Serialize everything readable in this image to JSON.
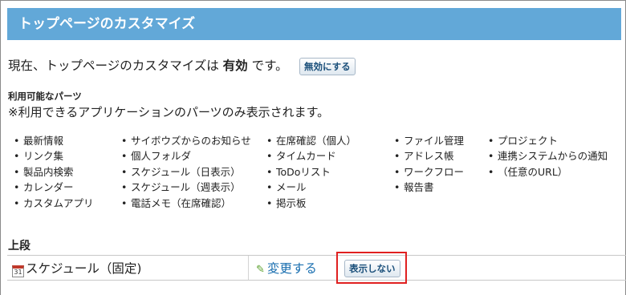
{
  "header": {
    "title": "トップページのカスタマイズ"
  },
  "status": {
    "prefix": "現在、トップページのカスタマイズは",
    "state": "有効",
    "suffix": "です。",
    "disable_label": "無効にする"
  },
  "parts": {
    "title": "利用可能なパーツ",
    "note": "※利用できるアプリケーションのパーツのみ表示されます。",
    "columns": [
      [
        "最新情報",
        "リンク集",
        "製品内検索",
        "カレンダー",
        "カスタムアプリ"
      ],
      [
        "サイボウズからのお知らせ",
        "個人フォルダ",
        "スケジュール（日表示）",
        "スケジュール（週表示）",
        "電話メモ（在席確認）"
      ],
      [
        "在席確認（個人）",
        "タイムカード",
        "ToDoリスト",
        "メール",
        "掲示板"
      ],
      [
        "ファイル管理",
        "アドレス帳",
        "ワークフロー",
        "報告書"
      ],
      [
        "プロジェクト",
        "連携システムからの通知",
        "（任意のURL）"
      ]
    ]
  },
  "upper": {
    "title": "上段",
    "row": {
      "name": "スケジュール（固定)",
      "calendar_day": "31",
      "change_label": "変更する",
      "hide_label": "表示しない"
    }
  },
  "colors": {
    "header_bg": "#62a8d8",
    "link": "#1a6fb0",
    "highlight": "#e02020"
  },
  "icons": {
    "calendar": "calendar-icon",
    "pencil": "pencil-icon"
  }
}
